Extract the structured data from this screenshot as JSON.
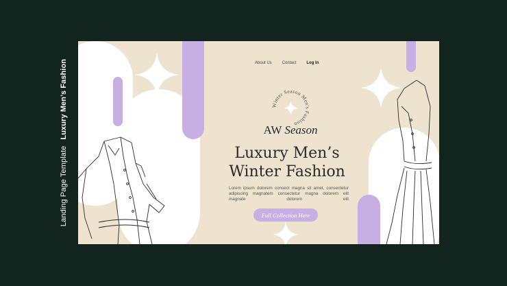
{
  "side_labels": {
    "template": "Landing Page Template",
    "title": "Luxury Men’s Fashion"
  },
  "nav": {
    "about": "About Us",
    "contact": "Contact",
    "login": "Log In"
  },
  "badge": {
    "ring_text": "Winter Season Men's Fashion"
  },
  "hero": {
    "tagline_a": "AW",
    "tagline_b": "Season",
    "title_line1": "Luxury Men’s",
    "title_line2": "Winter Fashion",
    "lorem": "Lorem ipsum dolorem consect magna sit amet, consectetur adipiscing magnatem consectetur magna dolorem elit magnate dolorem elit",
    "cta": "Full Collection Here"
  },
  "colors": {
    "background": "#11241e",
    "canvas": "#ede3cf",
    "lavender": "#c7aee3",
    "white": "#ffffff",
    "ink": "#2a2a2a"
  },
  "icons": [
    "sparkle-icon",
    "shirt-illustration",
    "dress-illustration"
  ]
}
